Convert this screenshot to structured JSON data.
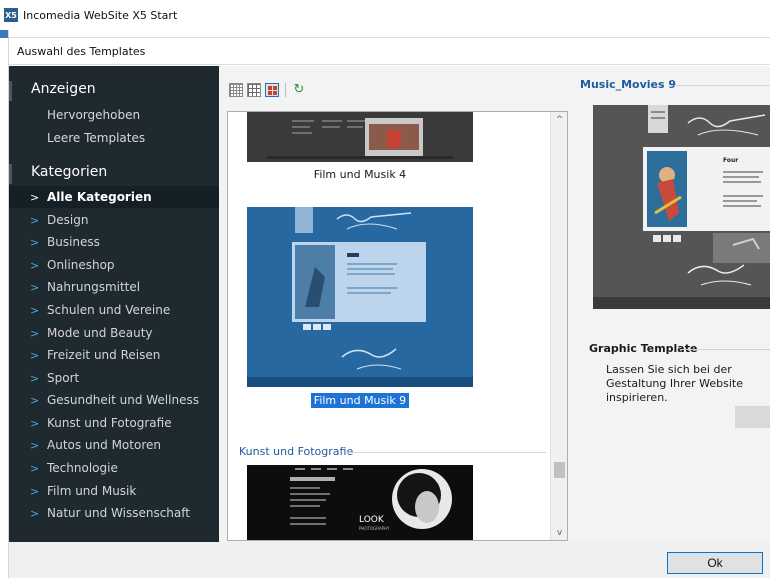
{
  "window": {
    "title": "Incomedia WebSite X5 Start",
    "logo_text": "X5"
  },
  "dialog": {
    "header": "Auswahl des Templates"
  },
  "sidebar": {
    "show_heading": "Anzeigen",
    "show_items": [
      {
        "label": "Hervorgehoben"
      },
      {
        "label": "Leere Templates"
      }
    ],
    "categories_heading": "Kategorien",
    "chevron": ">",
    "categories": [
      {
        "label": "Alle Kategorien",
        "active": true
      },
      {
        "label": "Design"
      },
      {
        "label": "Business"
      },
      {
        "label": "Onlineshop"
      },
      {
        "label": "Nahrungsmittel"
      },
      {
        "label": "Schulen und Vereine"
      },
      {
        "label": "Mode und Beauty"
      },
      {
        "label": "Freizeit und Reisen"
      },
      {
        "label": "Sport"
      },
      {
        "label": "Gesundheit und Wellness"
      },
      {
        "label": "Kunst und Fotografie"
      },
      {
        "label": "Autos und Motoren"
      },
      {
        "label": "Technologie"
      },
      {
        "label": "Film und Musik"
      },
      {
        "label": "Natur und Wissenschaft"
      }
    ]
  },
  "toolbar": {
    "icons": [
      "grid-small-icon",
      "grid-medium-icon",
      "grid-large-icon",
      "refresh-icon"
    ],
    "selected_view": "grid-large-icon"
  },
  "gallery": {
    "templates": [
      {
        "caption": "Film und Musik 4",
        "selected": false
      },
      {
        "caption": "Film und Musik 9",
        "selected": true
      }
    ],
    "next_section": "Kunst und Fotografie",
    "next_thumb_text": "LOOK",
    "next_thumb_subtext": "PHOTOGRAPHY",
    "scroll_up": "^",
    "scroll_down": "v"
  },
  "preview": {
    "title": "Music_Movies 9",
    "preview_heading": "Four",
    "type_label": "Graphic Template",
    "description": "Lassen Sie sich bei der Gestaltung Ihrer Website inspirieren."
  },
  "footer": {
    "ok_label": "Ok"
  },
  "colors": {
    "sidebar_bg": "#1f2a30",
    "accent_blue": "#1f5aa0",
    "selection_blue": "#1e74d6",
    "chevron_blue": "#4ba3d8"
  }
}
